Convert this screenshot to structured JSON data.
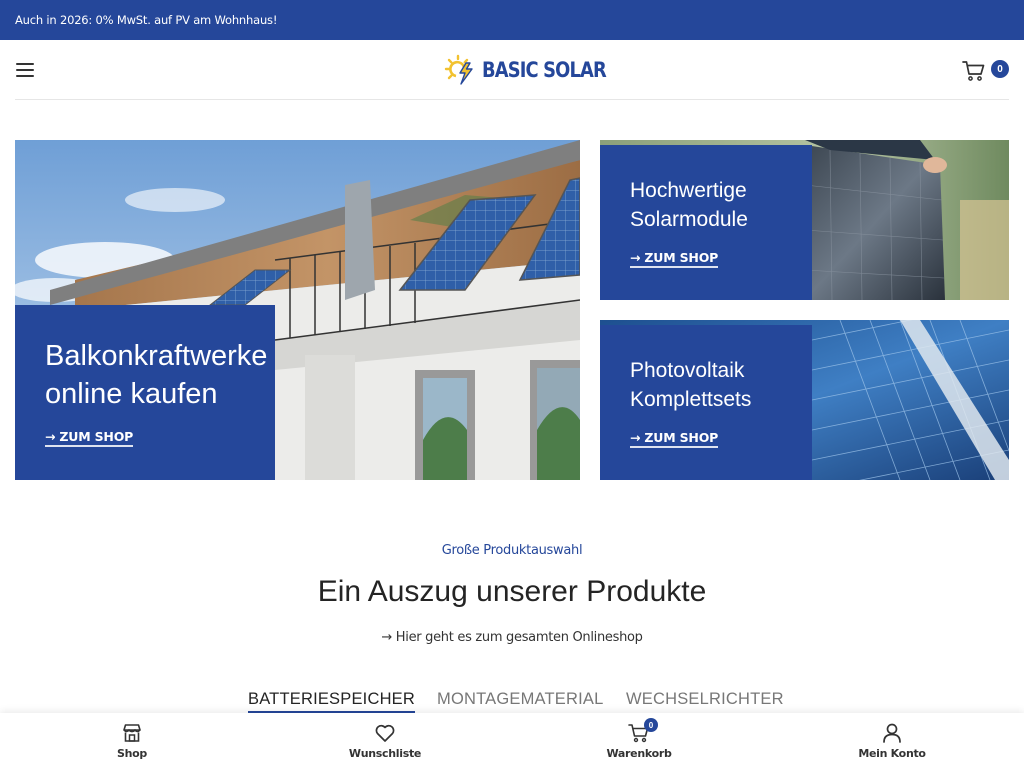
{
  "topbar": {
    "announcement": "Auch in 2026: 0% MwSt. auf PV am Wohnhaus!"
  },
  "header": {
    "menu_icon": "hamburger-menu-icon",
    "logo_text": "BASIC SOLAR",
    "logo_icon": "sun-bolt-icon",
    "cart_icon": "shopping-cart-icon",
    "cart_count": "0"
  },
  "banners": [
    {
      "title_line1": "Balkonkraftwerke",
      "title_line2": "online kaufen",
      "link": "→ ZUM SHOP",
      "image": "balcony-solar-photo"
    },
    {
      "title_line1": "Hochwertige",
      "title_line2": "Solarmodule",
      "link": "→ ZUM SHOP",
      "image": "solar-module-photo"
    },
    {
      "title_line1": "Photovoltaik",
      "title_line2": "Komplettsets",
      "link": "→ ZUM SHOP",
      "image": "pv-array-photo"
    }
  ],
  "section": {
    "subtitle": "Große Produktauswahl",
    "title": "Ein Auszug unserer Produkte",
    "link": "→ Hier geht es zum gesamten Onlineshop"
  },
  "tabs": [
    {
      "label": "BATTERIESPEICHER",
      "active": true
    },
    {
      "label": "MONTAGEMATERIAL",
      "active": false
    },
    {
      "label": "WECHSELRICHTER",
      "active": false
    }
  ],
  "bottom_nav": [
    {
      "label": "Shop",
      "icon": "store-icon"
    },
    {
      "label": "Wunschliste",
      "icon": "heart-icon"
    },
    {
      "label": "Warenkorb",
      "icon": "shopping-cart-icon",
      "badge": "0"
    },
    {
      "label": "Mein Konto",
      "icon": "user-icon"
    }
  ],
  "colors": {
    "brand_blue": "#25479a",
    "logo_yellow": "#f2c230",
    "text_dark": "#242424"
  }
}
